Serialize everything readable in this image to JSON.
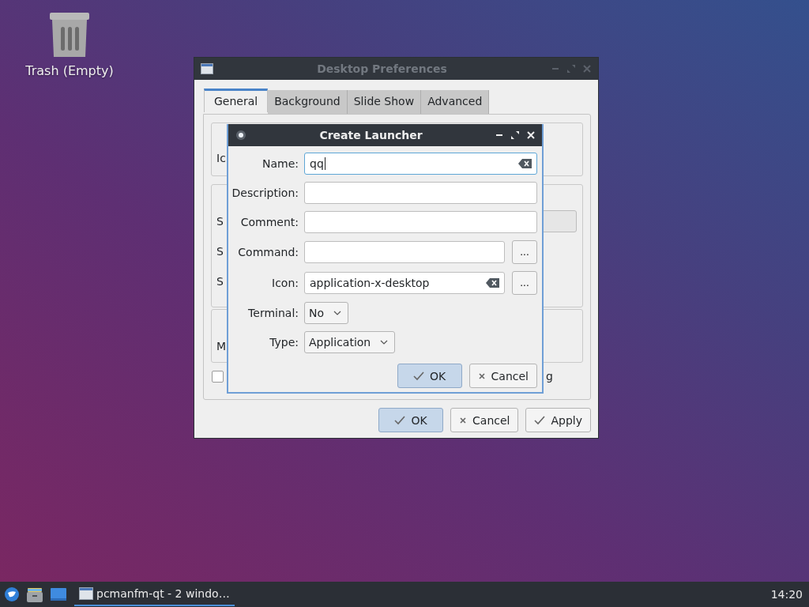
{
  "desktop": {
    "icons": [
      {
        "label": "Trash (Empty)"
      }
    ]
  },
  "preferences_window": {
    "title": "Desktop Preferences",
    "active": false,
    "tabs": [
      {
        "label": "General",
        "selected": true
      },
      {
        "label": "Background",
        "selected": false
      },
      {
        "label": "Slide Show",
        "selected": false
      },
      {
        "label": "Advanced",
        "selected": false
      }
    ],
    "group_1": {
      "label_fragments": [
        "Ic"
      ]
    },
    "group_2": {
      "label_fragments": [
        "S",
        "S",
        "S"
      ]
    },
    "group_3": {
      "label_fragments": [
        "M"
      ]
    },
    "checkbox": {
      "checked": false,
      "label_fragment": "g"
    },
    "buttons": [
      {
        "label": "OK",
        "kind": "ok",
        "default": true
      },
      {
        "label": "Cancel",
        "kind": "cancel",
        "default": false
      },
      {
        "label": "Apply",
        "kind": "ok",
        "default": false
      }
    ]
  },
  "launcher_window": {
    "title": "Create Launcher",
    "active": true,
    "fields": [
      {
        "label": "Name:",
        "kind": "text",
        "value": "qq",
        "focused": true,
        "clear_button": true
      },
      {
        "label": "Description:",
        "kind": "text",
        "focused": false
      },
      {
        "label": "Comment:",
        "kind": "text",
        "focused": false
      },
      {
        "label": "Command:",
        "kind": "text",
        "focused": false,
        "browse_button": "..."
      },
      {
        "label": "Icon:",
        "kind": "text",
        "value": "application-x-desktop",
        "focused": false,
        "clear_button": true,
        "browse_button": "..."
      },
      {
        "label": "Terminal:",
        "kind": "combo",
        "value": "No"
      },
      {
        "label": "Type:",
        "kind": "combo",
        "value": "Application"
      }
    ],
    "buttons": [
      {
        "label": "OK",
        "kind": "ok",
        "default": true
      },
      {
        "label": "Cancel",
        "kind": "cancel",
        "default": false
      }
    ]
  },
  "taskbar": {
    "tasks": [
      {
        "label": "pcmanfm-qt - 2 windo…",
        "selected": true
      }
    ],
    "clock": "14:20"
  }
}
